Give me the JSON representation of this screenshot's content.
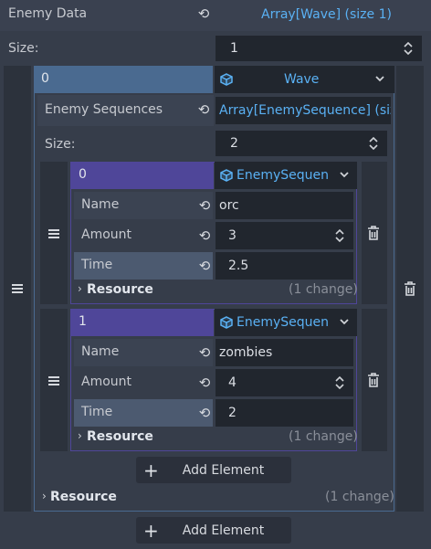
{
  "top": {
    "label": "Enemy Data",
    "value": "Array[Wave] (size 1)",
    "size_label": "Size:",
    "size_value": "1",
    "add_element": "Add Element"
  },
  "wave": {
    "index": "0",
    "type": "Wave",
    "seq_label": "Enemy Sequences",
    "seq_value": "Array[EnemySequence] (siz",
    "size_label": "Size:",
    "size_value": "2",
    "add_element": "Add Element",
    "resource_label": "Resource",
    "resource_changes": "(1 change)"
  },
  "items": [
    {
      "index": "0",
      "type": "EnemySequen",
      "name_label": "Name",
      "name_value": "orc",
      "amount_label": "Amount",
      "amount_value": "3",
      "time_label": "Time",
      "time_value": "2.5",
      "resource_label": "Resource",
      "resource_changes": "(1 change)"
    },
    {
      "index": "1",
      "type": "EnemySequen",
      "name_label": "Name",
      "name_value": "zombies",
      "amount_label": "Amount",
      "amount_value": "4",
      "time_label": "Time",
      "time_value": "2",
      "resource_label": "Resource",
      "resource_changes": "(1 change)"
    }
  ],
  "colors": {
    "wave_header": "#4a6a90",
    "item_header": "#4f4699",
    "accent": "#5ab1f4"
  }
}
